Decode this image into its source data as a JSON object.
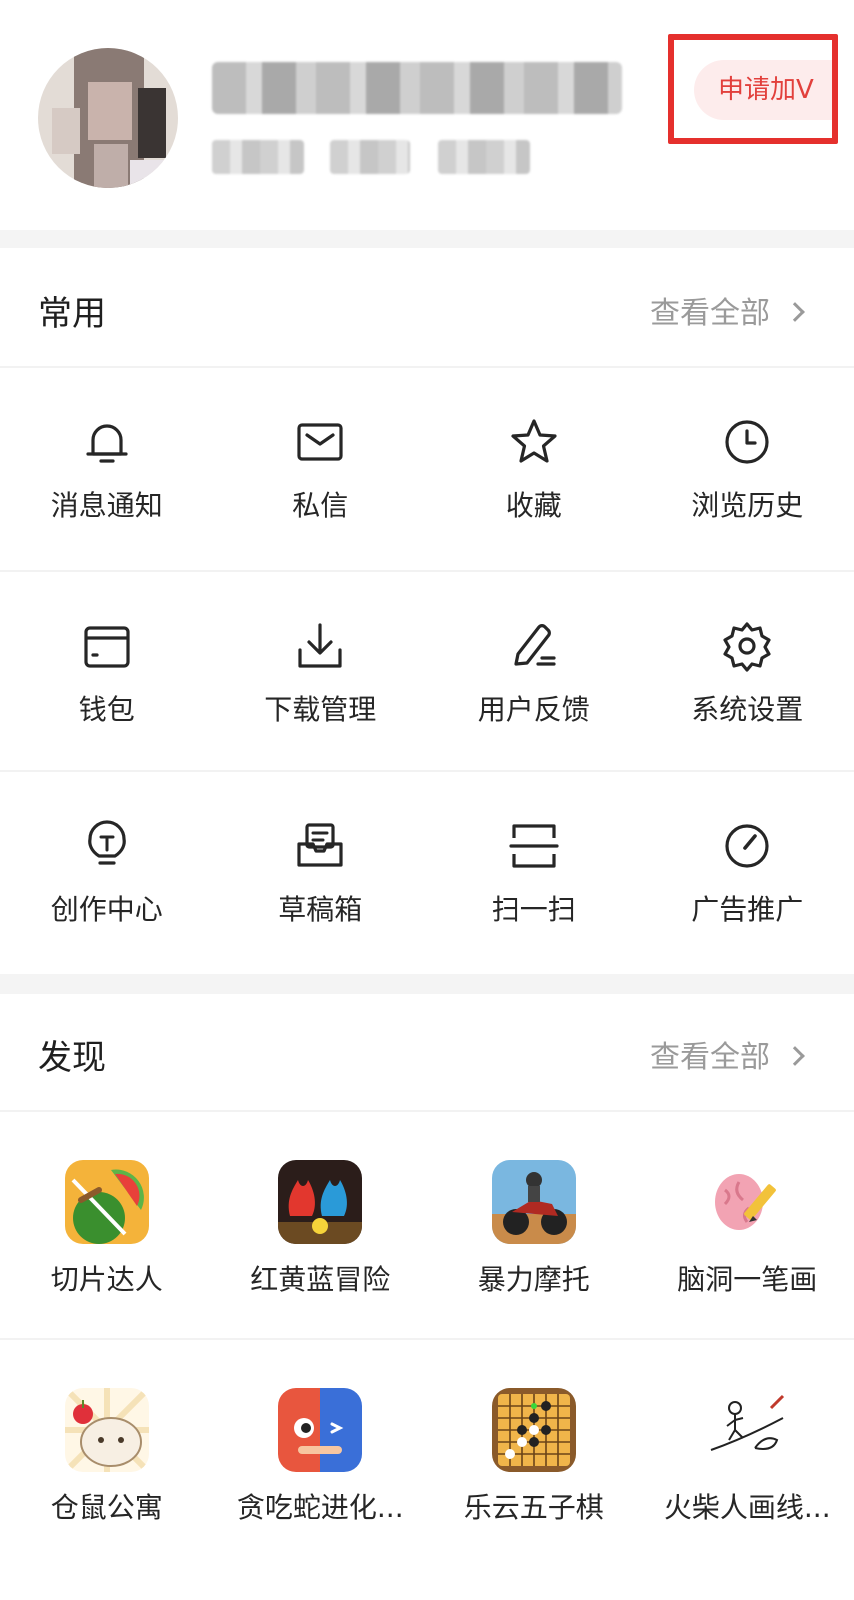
{
  "header": {
    "apply_v_label": "申请加V"
  },
  "common": {
    "title": "常用",
    "view_all": "查看全部",
    "rows": [
      [
        {
          "label": "消息通知",
          "icon": "bell-icon"
        },
        {
          "label": "私信",
          "icon": "mail-icon"
        },
        {
          "label": "收藏",
          "icon": "star-icon"
        },
        {
          "label": "浏览历史",
          "icon": "clock-icon"
        }
      ],
      [
        {
          "label": "钱包",
          "icon": "wallet-icon"
        },
        {
          "label": "下载管理",
          "icon": "download-icon"
        },
        {
          "label": "用户反馈",
          "icon": "pencil-icon"
        },
        {
          "label": "系统设置",
          "icon": "gear-icon"
        }
      ],
      [
        {
          "label": "创作中心",
          "icon": "lightbulb-icon"
        },
        {
          "label": "草稿箱",
          "icon": "draft-box-icon"
        },
        {
          "label": "扫一扫",
          "icon": "scan-icon"
        },
        {
          "label": "广告推广",
          "icon": "gauge-icon"
        }
      ]
    ]
  },
  "discover": {
    "title": "发现",
    "view_all": "查看全部",
    "rows": [
      [
        {
          "label": "切片达人",
          "icon": "watermelon-game-icon"
        },
        {
          "label": "红黄蓝冒险",
          "icon": "fire-water-game-icon"
        },
        {
          "label": "暴力摩托",
          "icon": "motorbike-game-icon"
        },
        {
          "label": "脑洞一笔画",
          "icon": "brain-pencil-game-icon"
        }
      ],
      [
        {
          "label": "仓鼠公寓",
          "icon": "hamster-game-icon"
        },
        {
          "label": "贪吃蛇进化...",
          "icon": "snake-game-icon"
        },
        {
          "label": "乐云五子棋",
          "icon": "gomoku-game-icon"
        },
        {
          "label": "火柴人画线...",
          "icon": "stickman-game-icon"
        }
      ]
    ]
  },
  "colors": {
    "accent": "#e2403c",
    "highlight_frame": "#e5302d",
    "background_gap": "#f4f4f4"
  }
}
